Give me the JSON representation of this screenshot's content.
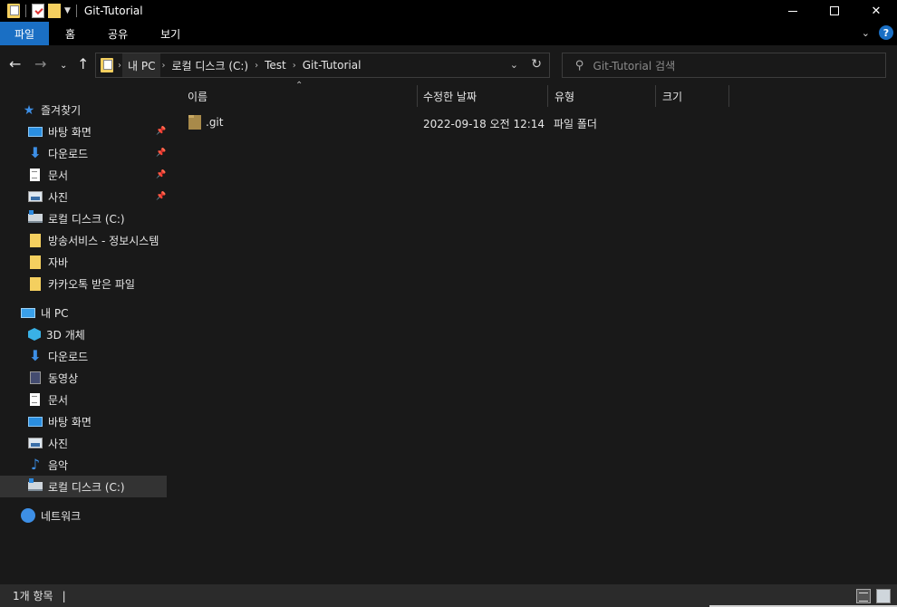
{
  "window": {
    "title": "Git-Tutorial",
    "controls": {
      "minimize": "—",
      "maximize": "☐",
      "close": "✕"
    }
  },
  "ribbon": {
    "tabs": [
      "파일",
      "홈",
      "공유",
      "보기"
    ],
    "help": "?"
  },
  "address": {
    "crumbs": [
      "내 PC",
      "로컬 디스크 (C:)",
      "Test",
      "Git-Tutorial"
    ]
  },
  "search": {
    "placeholder": "Git-Tutorial 검색"
  },
  "sidebar": {
    "quick_access": {
      "label": "즐겨찾기",
      "items": [
        {
          "label": "바탕 화면",
          "icon": "desktop-icon",
          "pinned": true
        },
        {
          "label": "다운로드",
          "icon": "download-icon",
          "pinned": true
        },
        {
          "label": "문서",
          "icon": "document-icon",
          "pinned": true
        },
        {
          "label": "사진",
          "icon": "pictures-icon",
          "pinned": true
        },
        {
          "label": "로컬 디스크 (C:)",
          "icon": "drive-icon",
          "pinned": false
        },
        {
          "label": "방송서비스 - 정보시스템",
          "icon": "folder-icon",
          "pinned": false
        },
        {
          "label": "자바",
          "icon": "folder-icon",
          "pinned": false
        },
        {
          "label": "카카오톡 받은 파일",
          "icon": "folder-icon",
          "pinned": false
        }
      ]
    },
    "this_pc": {
      "label": "내 PC",
      "items": [
        {
          "label": "3D 개체",
          "icon": "3d-objects-icon"
        },
        {
          "label": "다운로드",
          "icon": "download-icon"
        },
        {
          "label": "동영상",
          "icon": "video-icon"
        },
        {
          "label": "문서",
          "icon": "document-icon"
        },
        {
          "label": "바탕 화면",
          "icon": "desktop-icon"
        },
        {
          "label": "사진",
          "icon": "pictures-icon"
        },
        {
          "label": "음악",
          "icon": "music-icon"
        },
        {
          "label": "로컬 디스크 (C:)",
          "icon": "drive-icon",
          "selected": true
        }
      ]
    },
    "network": {
      "label": "네트워크"
    }
  },
  "columns": [
    "이름",
    "수정한 날짜",
    "유형",
    "크기"
  ],
  "files": [
    {
      "name": ".git",
      "modified": "2022-09-18 오전 12:14",
      "type": "파일 폴더",
      "size": ""
    }
  ],
  "status": {
    "count": "1개 항목",
    "sep": "|"
  }
}
